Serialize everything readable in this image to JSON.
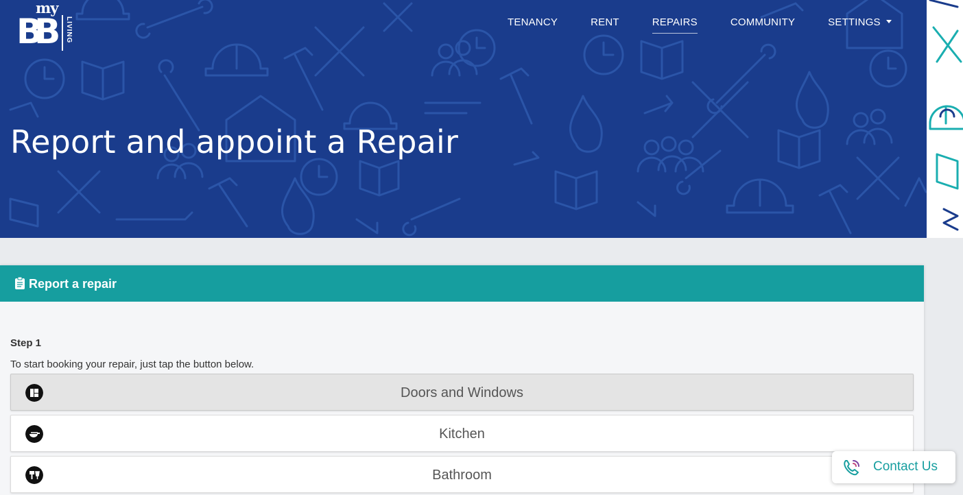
{
  "brand": {
    "my": "my",
    "bb": "BB",
    "living": "LIVING"
  },
  "nav": {
    "items": [
      {
        "label": "TENANCY"
      },
      {
        "label": "RENT"
      },
      {
        "label": "REPAIRS"
      },
      {
        "label": "COMMUNITY"
      },
      {
        "label": "SETTINGS"
      }
    ],
    "active": "REPAIRS"
  },
  "hero": {
    "title": "Report and appoint a Repair"
  },
  "card": {
    "title": "Report a repair",
    "icon": "clipboard-icon",
    "step_label": "Step 1",
    "step_desc": "To start booking your repair, just tap the button below.",
    "categories": [
      {
        "label": "Doors and Windows",
        "icon": "door-window-icon",
        "selected": true
      },
      {
        "label": "Kitchen",
        "icon": "kitchen-icon",
        "selected": false
      },
      {
        "label": "Bathroom",
        "icon": "bathroom-icon",
        "selected": false
      }
    ]
  },
  "contact": {
    "label": "Contact Us",
    "icon": "phone-icon"
  },
  "colors": {
    "hero_bg": "#1a3c8c",
    "accent": "#169e9f",
    "page_bg": "#e9ebee"
  }
}
